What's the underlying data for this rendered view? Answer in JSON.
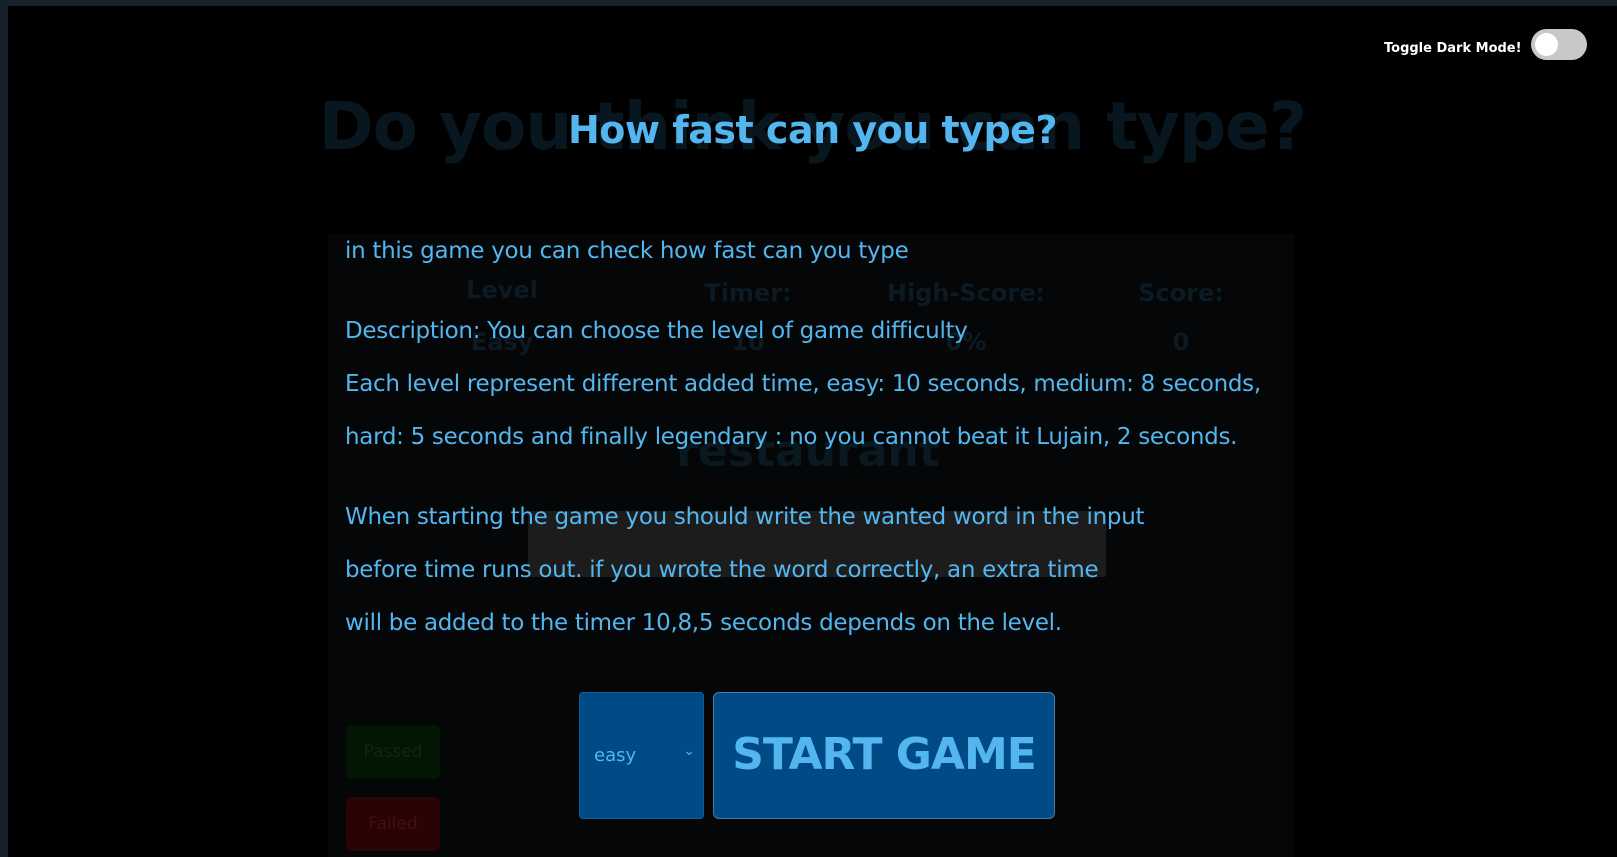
{
  "header": {
    "toggle_label": "Toggle Dark Mode!",
    "toggle_on": false
  },
  "background_game": {
    "title": "Do you think you can type?",
    "stats": [
      {
        "label": "Level",
        "value": "Easy"
      },
      {
        "label": "Timer:",
        "value": "10"
      },
      {
        "label": "High-Score:",
        "value": "0%"
      },
      {
        "label": "Score:",
        "value": "0"
      }
    ],
    "current_word": "restaurant",
    "passed_label": "Passed",
    "failed_label": "Failed"
  },
  "intro": {
    "title": "How fast can you type?",
    "lines": [
      "in this game you can check how fast can you type",
      "Description: You can choose the level of game difficulty",
      "Each level represent different added time, easy: 10 seconds, medium: 8 seconds,",
      "hard: 5 seconds and finally legendary : no you cannot beat it Lujain, 2 seconds.",
      "When starting the game you should write the wanted word in the input",
      "before time runs out. if you wrote the word correctly, an extra time",
      "will be added to the timer 10,8,5 seconds depends on the level."
    ],
    "difficulty": {
      "selected": "easy"
    },
    "start_label": "START GAME"
  },
  "colors": {
    "accent_text": "#53b6ee",
    "button_bg": "#004a85",
    "page_bg": "#000000"
  }
}
